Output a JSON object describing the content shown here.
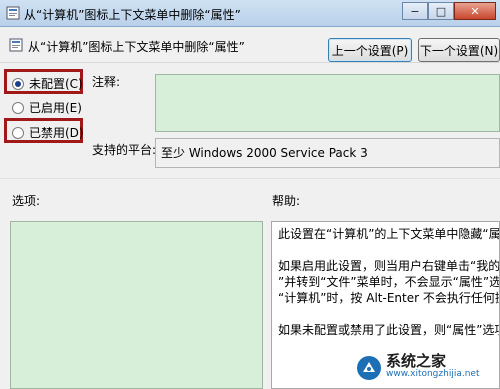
{
  "window": {
    "title": "从“计算机”图标上下文菜单中删除“属性”",
    "minimize": "−",
    "maximize": "□",
    "close": "✕"
  },
  "header": {
    "title": "从“计算机”图标上下文菜单中删除“属性”",
    "prev_button": "上一个设置(P)",
    "next_button": "下一个设置(N)"
  },
  "options": {
    "not_configured": "未配置(C)",
    "enabled": "已启用(E)",
    "disabled": "已禁用(D)",
    "selected": "not_configured"
  },
  "comment": {
    "label": "注释:",
    "value": ""
  },
  "platform": {
    "label": "支持的平台:",
    "value": "至少 Windows 2000 Service Pack 3"
  },
  "options_pane": {
    "label": "选项:"
  },
  "help_pane": {
    "label": "帮助:",
    "lines": [
      "此设置在“计算机”的上下文菜单中隐藏“属性”",
      "如果启用此设置，则当用户右键单击“我的电脑”",
      "”并转到“文件”菜单时，不会显示“属性”选项",
      "“计算机”时，按 Alt-Enter 不会执行任何操作。",
      "如果未配置或禁用了此设置，则“属性”选项将正"
    ]
  },
  "watermark": {
    "main": "系统之家",
    "sub": "www.xitongzhijia.net"
  },
  "colors": {
    "highlight": "#a01818",
    "green_panel": "#d7eed9",
    "titlebar": "#b9d1ea"
  }
}
